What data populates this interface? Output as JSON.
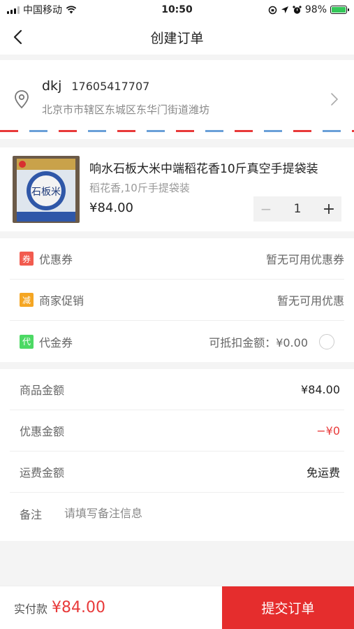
{
  "status_bar": {
    "carrier": "中国移动",
    "time": "10:50",
    "battery_percent": "98%",
    "battery_level": 0.98
  },
  "navbar": {
    "title": "创建订单",
    "back_icon": "chevron-left-icon"
  },
  "address": {
    "name": "dkj",
    "phone": "17605417707",
    "detail": "北京市市辖区东城区东华门街道潍坊"
  },
  "product": {
    "title": "响水石板大米中端稻花香10斤真空手提袋装",
    "spec": "稻花香,10斤手提袋装",
    "price": "¥84.00",
    "quantity": "1",
    "image_text": "石板米"
  },
  "discounts": [
    {
      "tag": "券",
      "tag_color": "#f25b4f",
      "label": "优惠券",
      "value": "暂无可用优惠券"
    },
    {
      "tag": "减",
      "tag_color": "#f5a623",
      "label": "商家促销",
      "value": "暂无可用优惠"
    },
    {
      "tag": "代",
      "tag_color": "#4cd964",
      "label": "代金券",
      "value": "可抵扣金额：¥0.00"
    }
  ],
  "summary": {
    "goods_label": "商品金额",
    "goods_value": "¥84.00",
    "discount_label": "优惠金额",
    "discount_value": "−¥0",
    "shipping_label": "运费金额",
    "shipping_value": "免运费",
    "note_label": "备注",
    "note_placeholder": "请填写备注信息"
  },
  "bottom": {
    "pay_label": "实付款",
    "pay_amount": "¥84.00",
    "submit_label": "提交订单"
  },
  "colors": {
    "accent_red": "#e52d2d",
    "stripe_red": "#e83a3a",
    "stripe_blue": "#6aa0d8"
  }
}
